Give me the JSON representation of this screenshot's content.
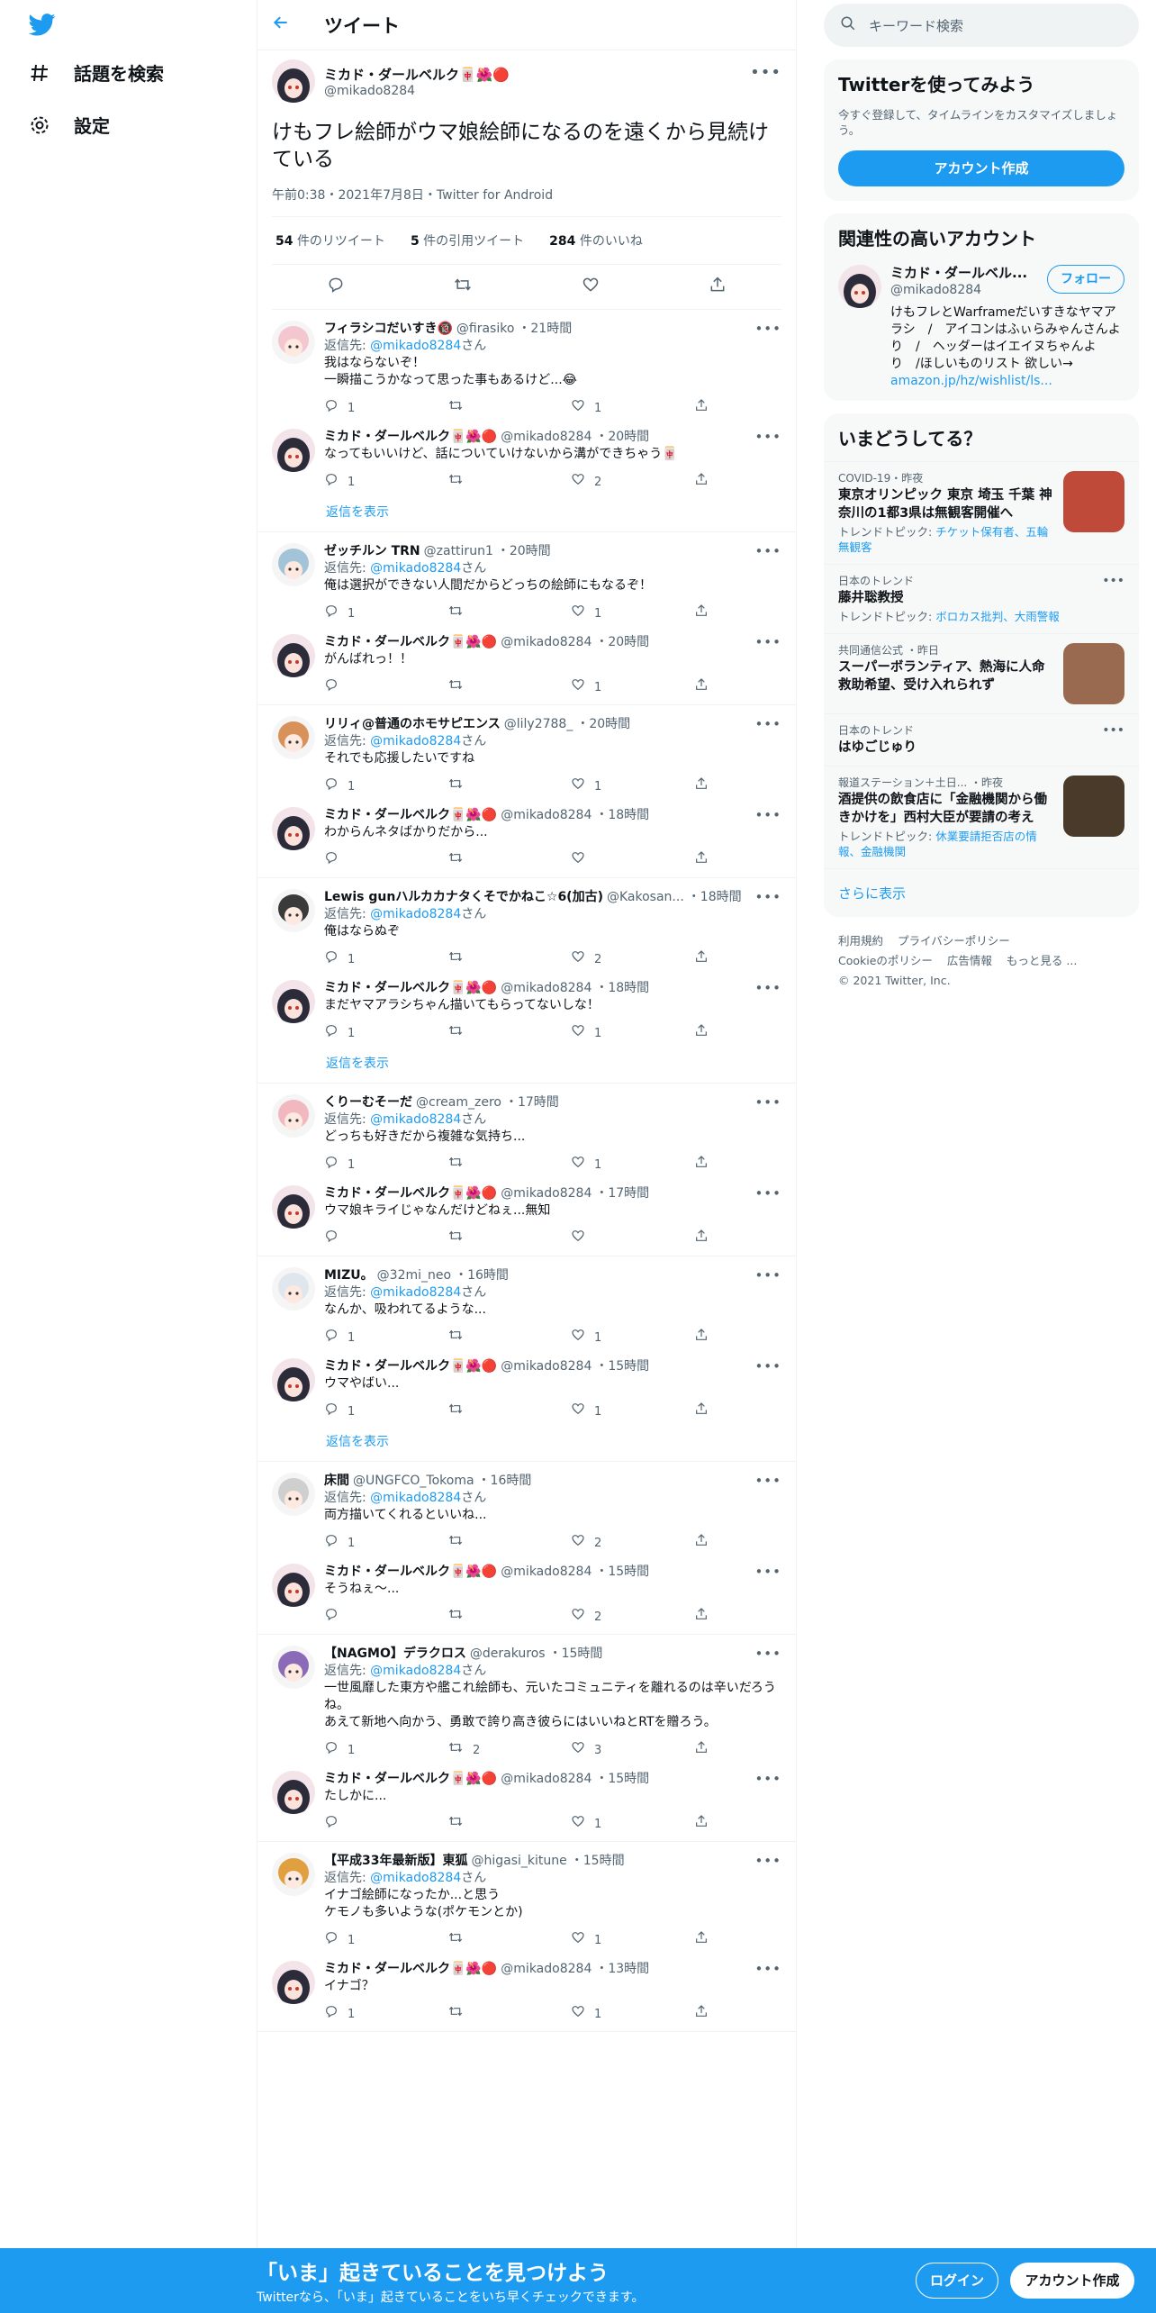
{
  "colors": {
    "accent": "#1d9bf0",
    "text": "#0f1419",
    "muted": "#536471"
  },
  "nav": {
    "explore": "話題を検索",
    "settings": "設定"
  },
  "header": {
    "title": "ツイート"
  },
  "focus": {
    "name": "ミカド・ダールベルク🀄🌺🔴",
    "handle": "@mikado8284",
    "text": "けもフレ絵師がウマ娘絵師になるのを遠くから見続けている",
    "meta": "午前0:38・2021年7月8日・Twitter for Android",
    "retweets": "54",
    "retweets_label": "件のリツイート",
    "quotes": "5",
    "quotes_label": "件の引用ツイート",
    "likes": "284",
    "likes_label": "件のいいね"
  },
  "reply_prefix": "返信先: ",
  "reply_suffix": "さん",
  "show_replies": "返信を表示",
  "threads": [
    {
      "tweets": [
        {
          "name": "フィラシコだいすき🔞",
          "handle": "@firasiko",
          "time": "・21時間",
          "reply_to": "@mikado8284",
          "text": "我はならないぞ！\n一瞬描こうかなって思った事もあるけど...😂",
          "reply": "1",
          "rt": "",
          "like": "1",
          "avatar": "#f4c7d0"
        },
        {
          "name": "ミカド・ダールベルク🀄🌺🔴",
          "handle": "@mikado8284",
          "time": "・20時間",
          "reply_to": "",
          "text": "なってもいいけど、話についていけないから溝ができちゃう🀄",
          "reply": "1",
          "rt": "",
          "like": "2",
          "avatar": "#2b2b3a"
        }
      ],
      "show_more": true
    },
    {
      "tweets": [
        {
          "name": "ゼッチルン TRN",
          "handle": "@zattirun1",
          "time": "・20時間",
          "reply_to": "@mikado8284",
          "text": "俺は選択ができない人間だからどっちの絵師にもなるぞ！",
          "reply": "1",
          "rt": "",
          "like": "1",
          "avatar": "#a3c4d8"
        },
        {
          "name": "ミカド・ダールベルク🀄🌺🔴",
          "handle": "@mikado8284",
          "time": "・20時間",
          "reply_to": "",
          "text": "がんばれっ！！",
          "reply": "",
          "rt": "",
          "like": "1",
          "avatar": "#2b2b3a"
        }
      ],
      "show_more": false
    },
    {
      "tweets": [
        {
          "name": "リリィ@普通のホモサピエンス",
          "handle": "@lily2788_",
          "time": "・20時間",
          "reply_to": "@mikado8284",
          "text": "それでも応援したいですね",
          "reply": "1",
          "rt": "",
          "like": "1",
          "avatar": "#d9915a"
        },
        {
          "name": "ミカド・ダールベルク🀄🌺🔴",
          "handle": "@mikado8284",
          "time": "・18時間",
          "reply_to": "",
          "text": "わからんネタばかりだから...",
          "reply": "",
          "rt": "",
          "like": "",
          "avatar": "#2b2b3a"
        }
      ],
      "show_more": false
    },
    {
      "tweets": [
        {
          "name": "Lewis gunハルカカナタくそでかねこ☆6(加古)",
          "handle": "@Kakosan...",
          "time": "・18時間",
          "reply_to": "@mikado8284",
          "text": "俺はならぬぞ",
          "reply": "1",
          "rt": "",
          "like": "2",
          "avatar": "#3a3a3a"
        },
        {
          "name": "ミカド・ダールベルク🀄🌺🔴",
          "handle": "@mikado8284",
          "time": "・18時間",
          "reply_to": "",
          "text": "まだヤマアラシちゃん描いてもらってないしな！",
          "reply": "1",
          "rt": "",
          "like": "1",
          "avatar": "#2b2b3a"
        }
      ],
      "show_more": true
    },
    {
      "tweets": [
        {
          "name": "くりーむそーだ",
          "handle": "@cream_zero",
          "time": "・17時間",
          "reply_to": "@mikado8284",
          "text": "どっちも好きだから複雑な気持ち...",
          "reply": "1",
          "rt": "",
          "like": "1",
          "avatar": "#f2b8c0"
        },
        {
          "name": "ミカド・ダールベルク🀄🌺🔴",
          "handle": "@mikado8284",
          "time": "・17時間",
          "reply_to": "",
          "text": "ウマ娘キライじゃなんだけどねぇ...無知",
          "reply": "",
          "rt": "",
          "like": "",
          "avatar": "#2b2b3a"
        }
      ],
      "show_more": false
    },
    {
      "tweets": [
        {
          "name": "MIZU。",
          "handle": "@32mi_neo",
          "time": "・16時間",
          "reply_to": "@mikado8284",
          "text": "なんか、吸われてるような...",
          "reply": "1",
          "rt": "",
          "like": "1",
          "avatar": "#dfe6ee"
        },
        {
          "name": "ミカド・ダールベルク🀄🌺🔴",
          "handle": "@mikado8284",
          "time": "・15時間",
          "reply_to": "",
          "text": "ウマやばい...",
          "reply": "1",
          "rt": "",
          "like": "1",
          "avatar": "#2b2b3a"
        }
      ],
      "show_more": true
    },
    {
      "tweets": [
        {
          "name": "床間",
          "handle": "@UNGFCO_Tokoma",
          "time": "・16時間",
          "reply_to": "@mikado8284",
          "text": "両方描いてくれるといいね...",
          "reply": "1",
          "rt": "",
          "like": "2",
          "avatar": "#cfcfcf"
        },
        {
          "name": "ミカド・ダールベルク🀄🌺🔴",
          "handle": "@mikado8284",
          "time": "・15時間",
          "reply_to": "",
          "text": "そうねぇ〜...",
          "reply": "",
          "rt": "",
          "like": "2",
          "avatar": "#2b2b3a"
        }
      ],
      "show_more": false
    },
    {
      "tweets": [
        {
          "name": "【NAGMO】デラクロス",
          "handle": "@derakuros",
          "time": "・15時間",
          "reply_to": "@mikado8284",
          "text": "一世風靡した東方や艦これ絵師も、元いたコミュニティを離れるのは辛いだろうね。\nあえて新地へ向かう、勇敢で誇り高き彼らにはいいねとRTを贈ろう。",
          "reply": "1",
          "rt": "2",
          "like": "3",
          "avatar": "#8b6bb8"
        },
        {
          "name": "ミカド・ダールベルク🀄🌺🔴",
          "handle": "@mikado8284",
          "time": "・15時間",
          "reply_to": "",
          "text": "たしかに...",
          "reply": "",
          "rt": "",
          "like": "1",
          "avatar": "#2b2b3a"
        }
      ],
      "show_more": false
    },
    {
      "tweets": [
        {
          "name": "【平成33年最新版】東狐",
          "handle": "@higasi_kitune",
          "time": "・15時間",
          "reply_to": "@mikado8284",
          "text": "イナゴ絵師になったか...と思う\nケモノも多いような(ポケモンとか)",
          "reply": "1",
          "rt": "",
          "like": "1",
          "avatar": "#e0a040"
        },
        {
          "name": "ミカド・ダールベルク🀄🌺🔴",
          "handle": "@mikado8284",
          "time": "・13時間",
          "reply_to": "",
          "text": "イナゴ？",
          "reply": "1",
          "rt": "",
          "like": "1",
          "avatar": "#2b2b3a"
        }
      ],
      "show_more": false
    }
  ],
  "right": {
    "search_placeholder": "キーワード検索",
    "signup": {
      "title": "Twitterを使ってみよう",
      "desc": "今すぐ登録して、タイムラインをカスタマイズしましょう。",
      "button": "アカウント作成"
    },
    "related": {
      "title": "関連性の高いアカウント",
      "name": "ミカド・ダールベル...",
      "handle": "@mikado8284",
      "follow": "フォロー",
      "bio": "けもフレとWarframeだいすきなヤマアラシ　/　アイコンはふぃらみゃんさんより　/　ヘッダーはイエイヌちゃんより　/ほしいものリスト 欲しい→ ",
      "bio_link": "amazon.jp/hz/wishlist/ls..."
    },
    "trends": {
      "title": "いまどうしてる？",
      "items": [
        {
          "cat": "COVID-19・昨夜",
          "title": "東京オリンピック 東京 埼玉 千葉 神奈川の1都3県は無観客開催へ",
          "topic_prefix": "トレンドトピック: ",
          "topic": "チケット保有者、五輪無観客",
          "thumb": "#c04a3a"
        },
        {
          "cat": "日本のトレンド",
          "title": "藤井聡教授",
          "topic_prefix": "トレンドトピック: ",
          "topic": "ボロカス批判、大雨警報",
          "thumb": ""
        },
        {
          "cat": "共同通信公式 ・昨日",
          "title": "スーパーボランティア、熱海に人命救助希望、受け入れられず",
          "topic_prefix": "",
          "topic": "",
          "thumb": "#9a6a50"
        },
        {
          "cat": "日本のトレンド",
          "title": "はゆごじゅり",
          "topic_prefix": "",
          "topic": "",
          "thumb": ""
        },
        {
          "cat": "報道ステーション＋土日... ・昨夜",
          "title": "酒提供の飲食店に「金融機関から働きかけを」西村大臣が要請の考え",
          "topic_prefix": "トレンドトピック: ",
          "topic": "休業要請拒否店の情報、金融機関",
          "thumb": "#4a3a2a"
        }
      ],
      "show_more": "さらに表示"
    },
    "footer": [
      "利用規約",
      "プライバシーポリシー",
      "Cookieのポリシー",
      "広告情報",
      "もっと見る ...",
      "© 2021 Twitter, Inc."
    ]
  },
  "bottom": {
    "headline": "「いま」起きていることを見つけよう",
    "sub": "Twitterなら、「いま」起きていることをいち早くチェックできます。",
    "login": "ログイン",
    "signup": "アカウント作成"
  }
}
